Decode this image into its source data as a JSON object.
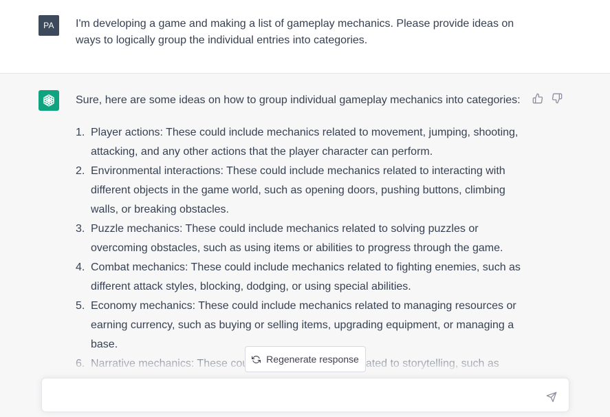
{
  "user_message": {
    "avatar_initials": "PA",
    "text": "I'm developing a game and making a list of gameplay mechanics. Please provide ideas on ways to logically group the individual entries into categories."
  },
  "assistant_message": {
    "intro": "Sure, here are some ideas on how to group individual gameplay mechanics into categories:",
    "items": [
      {
        "number": "1.",
        "text": "Player actions: These could include mechanics related to movement, jumping, shooting, attacking, and any other actions that the player character can perform."
      },
      {
        "number": "2.",
        "text": "Environmental interactions: These could include mechanics related to interacting with different objects in the game world, such as opening doors, pushing buttons, climbing walls, or breaking obstacles."
      },
      {
        "number": "3.",
        "text": "Puzzle mechanics: These could include mechanics related to solving puzzles or overcoming obstacles, such as using items or abilities to progress through the game."
      },
      {
        "number": "4.",
        "text": "Combat mechanics: These could include mechanics related to fighting enemies, such as different attack styles, blocking, dodging, or using special abilities."
      },
      {
        "number": "5.",
        "text": "Economy mechanics: These could include mechanics related to managing resources or earning currency, such as buying or selling items, upgrading equipment, or managing a base."
      },
      {
        "number": "6.",
        "text": "Narrative mechanics: These could include mechanics related to storytelling, such as"
      }
    ]
  },
  "controls": {
    "regenerate_label": "Regenerate response",
    "input_placeholder": ""
  },
  "icons": {
    "thumbs_up": "thumbs-up-icon",
    "thumbs_down": "thumbs-down-icon",
    "regenerate": "refresh-icon",
    "send": "send-icon",
    "bot_logo": "openai-logo-icon"
  },
  "colors": {
    "bot_avatar": "#10a37f",
    "user_avatar": "#3d4a5c",
    "assistant_background": "#f7f7f8"
  }
}
